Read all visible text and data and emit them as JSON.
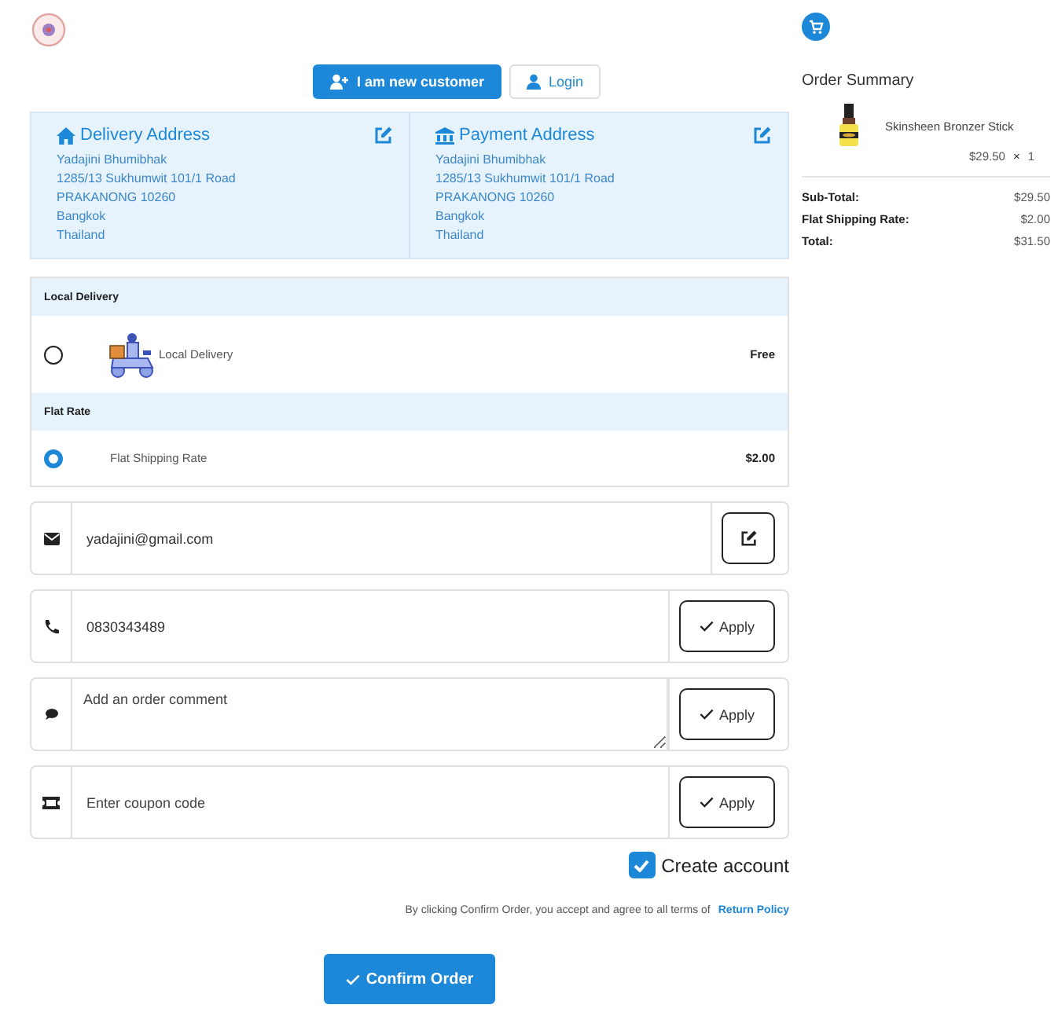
{
  "account_buttons": [
    {
      "label": "I am new customer",
      "kind": "new",
      "selected": true
    },
    {
      "label": "Login",
      "kind": "login",
      "selected": false
    }
  ],
  "addresses": [
    {
      "title": "Delivery Address",
      "kind": "home",
      "lines": [
        "Yadajini Bhumibhak",
        "1285/13 Sukhumwit 101/1 Road",
        "PRAKANONG 10260",
        "Bangkok",
        "Thailand"
      ]
    },
    {
      "title": "Payment Address",
      "kind": "bank",
      "lines": [
        "Yadajini Bhumibhak",
        "1285/13 Sukhumwit 101/1 Road",
        "PRAKANONG 10260",
        "Bangkok",
        "Thailand"
      ]
    }
  ],
  "shipping_groups": [
    {
      "title": "Local Delivery",
      "options": [
        {
          "label": "Local Delivery",
          "price": "Free",
          "selected": false,
          "kind": "scooter"
        }
      ]
    },
    {
      "title": "Flat Rate",
      "options": [
        {
          "label": "Flat Shipping Rate",
          "price": "$2.00",
          "selected": true,
          "kind": "plain"
        }
      ]
    }
  ],
  "fields": [
    {
      "kind": "email",
      "value": "yadajini@gmail.com",
      "button": {
        "kind": "edit"
      }
    },
    {
      "kind": "phone",
      "value": "0830343489",
      "button": {
        "kind": "apply",
        "label": "Apply"
      }
    },
    {
      "kind": "comment",
      "placeholder": "Add an order comment",
      "button": {
        "kind": "apply",
        "label": "Apply"
      }
    },
    {
      "kind": "coupon",
      "placeholder": "Enter coupon code",
      "button": {
        "kind": "apply",
        "label": "Apply"
      }
    }
  ],
  "create_account": {
    "label": "Create account",
    "checked": true
  },
  "terms": {
    "text": "By clicking Confirm Order, you accept and agree to all terms of",
    "link": "Return Policy"
  },
  "confirm_button": "Confirm Order",
  "order_summary": {
    "title": "Order Summary",
    "items": [
      {
        "name": "Skinsheen Bronzer Stick",
        "price": "$29.50",
        "times": "×",
        "quantity": "1"
      }
    ],
    "totals": [
      {
        "label": "Sub-Total:",
        "value": "$29.50"
      },
      {
        "label": "Flat Shipping Rate:",
        "value": "$2.00"
      },
      {
        "label": "Total:",
        "value": "$31.50"
      }
    ]
  }
}
